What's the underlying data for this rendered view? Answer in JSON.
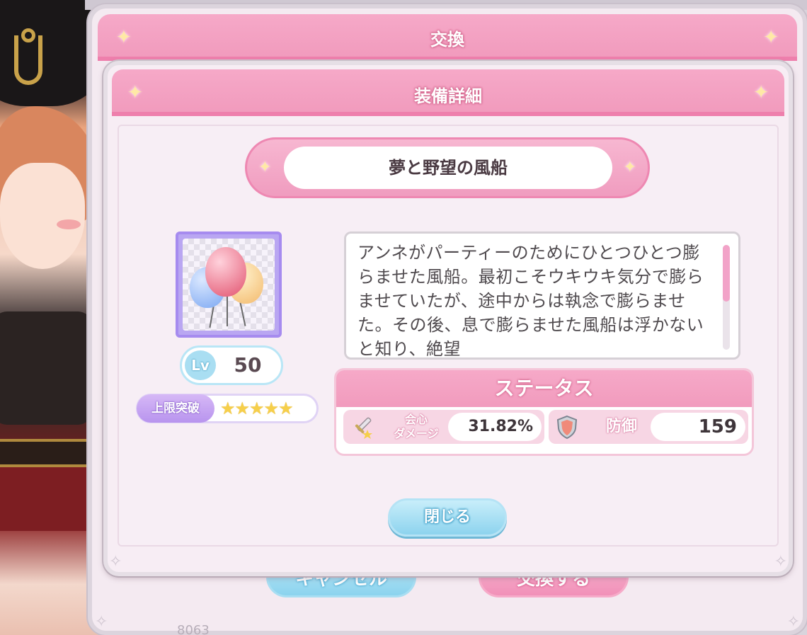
{
  "outer_dialog": {
    "title": "交換",
    "cancel_label": "キャンセル",
    "confirm_label": "交換する",
    "partial_number": "8063"
  },
  "detail_dialog": {
    "title": "装備詳細",
    "item_name": "夢と野望の風船",
    "item_icon": "balloons-icon",
    "level_badge": "Lv",
    "level_value": "50",
    "limit_break_label": "上限突破",
    "limit_break_stars": 5,
    "limit_break_stars_text": "★★★★★",
    "description": "アンネがパーティーのためにひとつひとつ膨らませた風船。最初こそウキウキ気分で膨らませていたが、途中からは執念で膨らませた。その後、息で膨らませた風船は浮かないと知り、絶望",
    "status_title": "ステータス",
    "stats": [
      {
        "label_line1": "会心",
        "label_line2": "ダメージ",
        "value": "31.82%",
        "icon": "sword-icon"
      },
      {
        "label": "防御",
        "value": "159",
        "icon": "shield-icon"
      }
    ],
    "close_label": "閉じる"
  },
  "colors": {
    "header_pink": "#f19bbd",
    "accent_blue": "#8dd3ee",
    "limit_purple": "#b894ee",
    "star_gold": "#f6cf4a"
  }
}
